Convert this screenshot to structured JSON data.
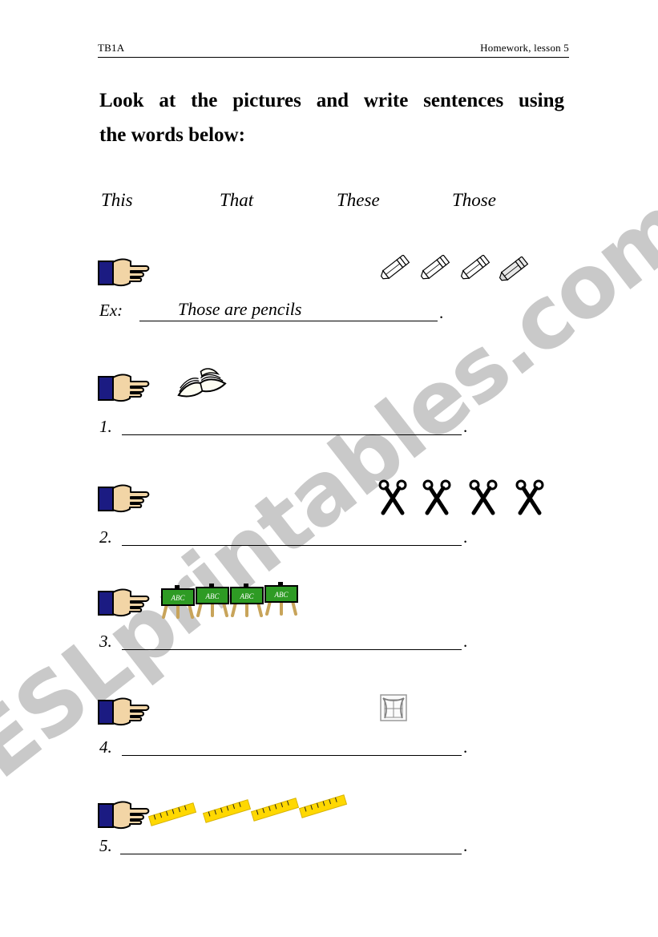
{
  "document": {
    "header": {
      "code": "TB1A",
      "right_note": "Homework, lesson 5"
    },
    "title": {
      "line1": "Look at the pictures and write sentences using",
      "line2": "the words below:"
    },
    "word_bank": {
      "label": "word-bank",
      "words": [
        "This",
        "That",
        "These",
        "Those"
      ]
    },
    "exercises": [
      {
        "number": "Ex:",
        "answer": "Those are pencils",
        "end_punctuation": ".",
        "picture": {
          "icon": "pointing-hand-icon",
          "subject_icon": "pencil-icon",
          "subject_count": 4,
          "subject_name": "pencils"
        }
      },
      {
        "number": "1.",
        "answer": "",
        "end_punctuation": ".",
        "picture": {
          "icon": "pointing-hand-icon",
          "subject_icon": "open-book-icon",
          "subject_count": 1,
          "subject_name": "book"
        }
      },
      {
        "number": "2.",
        "answer": "",
        "end_punctuation": ".",
        "picture": {
          "icon": "pointing-hand-icon",
          "subject_icon": "scissors-icon",
          "subject_count": 4,
          "subject_name": "scissors"
        }
      },
      {
        "number": "3.",
        "answer": "",
        "end_punctuation": ".",
        "picture": {
          "icon": "pointing-hand-icon",
          "subject_icon": "blackboard-icon",
          "subject_count": 4,
          "subject_name": "blackboards",
          "subject_text": "ABC"
        }
      },
      {
        "number": "4.",
        "answer": "",
        "end_punctuation": ".",
        "picture": {
          "icon": "pointing-hand-icon",
          "subject_icon": "window-icon",
          "subject_count": 1,
          "subject_name": "window"
        }
      },
      {
        "number": "5.",
        "answer": "",
        "end_punctuation": ".",
        "picture": {
          "icon": "pointing-hand-icon",
          "subject_icon": "ruler-icon",
          "subject_count": 4,
          "subject_name": "rulers"
        }
      }
    ],
    "watermark": {
      "text": "ESLprintables.com",
      "color": "#c9c9c9"
    },
    "colors": {
      "ink": "#000000",
      "paper": "#ffffff",
      "hand_skin": "#f2d5a6",
      "hand_cuff": "#1b1b82",
      "board_green": "#2e9b24",
      "board_frame": "#000000",
      "board_wood": "#c8a45a",
      "ruler_yellow": "#ffd800"
    }
  }
}
